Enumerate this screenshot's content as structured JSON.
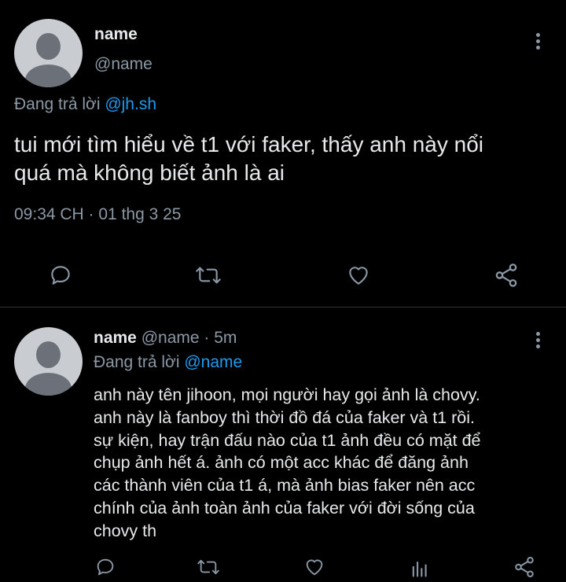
{
  "main_tweet": {
    "display_name": "name",
    "handle": "@name",
    "replying_prefix": "Đang trả lời",
    "replying_to": "@jh.sh",
    "text_line1": "tui mới tìm hiểu về t1 với faker, thấy anh này nổi",
    "text_line2": "quá mà không biết ảnh là ai",
    "timestamp": "09:34 CH · 01 thg 3 25"
  },
  "reply": {
    "display_name": "name",
    "handle": "@name",
    "separator": "·",
    "time_ago": "5m",
    "replying_prefix": "Đang trả lời",
    "replying_to": "@name",
    "lines": [
      "anh này tên jihoon, mọi người hay gọi ảnh là chovy.",
      "anh này là fanboy thì thời đồ đá của faker và t1 rồi.",
      "sự kiện, hay trận đấu nào của t1 ảnh đều có mặt để",
      "chụp ảnh hết á. ảnh có một acc khác để đăng ảnh",
      "các thành viên của t1 á, mà ảnh bias faker nên acc",
      "chính của ảnh toàn ảnh của faker với đời sống của",
      "chovy th"
    ]
  },
  "icons": [
    "reply-icon",
    "retweet-icon",
    "like-icon",
    "share-icon",
    "views-icon",
    "more-icon"
  ],
  "colors": {
    "background": "#000000",
    "text": "#e7e9ea",
    "muted": "#8b98a5",
    "link": "#1d9bf0",
    "divider": "#2f3336"
  }
}
